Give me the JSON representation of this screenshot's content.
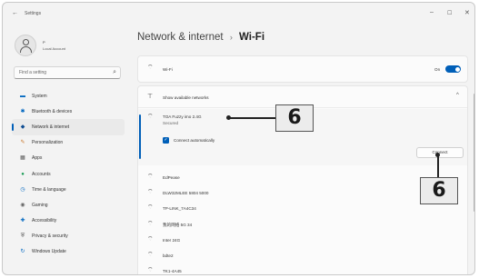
{
  "window": {
    "title": "Settings",
    "back_glyph": "←",
    "min_glyph": "–",
    "max_glyph": "☐",
    "close_glyph": "✕"
  },
  "user": {
    "name": "P",
    "account_type": "Local Account"
  },
  "search": {
    "placeholder": "Find a setting",
    "icon": "search-icon"
  },
  "sidebar": {
    "items": [
      {
        "label": "System",
        "icon": "monitor-icon",
        "glyph": "▬",
        "color": "#0067c0",
        "active": false
      },
      {
        "label": "Bluetooth & devices",
        "icon": "bluetooth-icon",
        "glyph": "✱",
        "color": "#0067c0",
        "active": false
      },
      {
        "label": "Network & internet",
        "icon": "network-icon",
        "glyph": "◆",
        "color": "#0f4d92",
        "active": true
      },
      {
        "label": "Personalization",
        "icon": "brush-icon",
        "glyph": "✎",
        "color": "#c97a2f",
        "active": false
      },
      {
        "label": "Apps",
        "icon": "apps-icon",
        "glyph": "▦",
        "color": "#555555",
        "active": false
      },
      {
        "label": "Accounts",
        "icon": "person-icon",
        "glyph": "●",
        "color": "#1a9c55",
        "active": false
      },
      {
        "label": "Time & language",
        "icon": "globe-clock-icon",
        "glyph": "◷",
        "color": "#0067c0",
        "active": false
      },
      {
        "label": "Gaming",
        "icon": "controller-icon",
        "glyph": "◉",
        "color": "#666666",
        "active": false
      },
      {
        "label": "Accessibility",
        "icon": "accessibility-icon",
        "glyph": "✚",
        "color": "#0067c0",
        "active": false
      },
      {
        "label": "Privacy & security",
        "icon": "shield-icon",
        "glyph": "⛨",
        "color": "#555555",
        "active": false
      },
      {
        "label": "Windows Update",
        "icon": "update-icon",
        "glyph": "↻",
        "color": "#0067c0",
        "active": false
      }
    ]
  },
  "breadcrumb": {
    "parent": "Network & internet",
    "separator": "›",
    "current": "Wi-Fi"
  },
  "wifi": {
    "label": "Wi-Fi",
    "toggle_state": "On",
    "toggle_on": true,
    "accent_color": "#005fb8"
  },
  "available": {
    "label": "Show available networks",
    "chevron": "^"
  },
  "selected_network": {
    "name": "TOA Fuzzy imo 2.4G",
    "status": "Secured",
    "auto_connect_label": "Connect automatically",
    "auto_connect_checked": true,
    "connect_label": "Connect"
  },
  "networks": [
    {
      "name": "EdPease"
    },
    {
      "name": "DLW32MLEE 5804 5000"
    },
    {
      "name": "TP-LINK_7A4C34"
    },
    {
      "name": "我的网络 5G 34"
    },
    {
      "name": "Inter 24G"
    },
    {
      "name": "bdte2"
    },
    {
      "name": "TK1-4A45"
    }
  ],
  "callouts": [
    {
      "label": "6"
    },
    {
      "label": "6"
    }
  ]
}
